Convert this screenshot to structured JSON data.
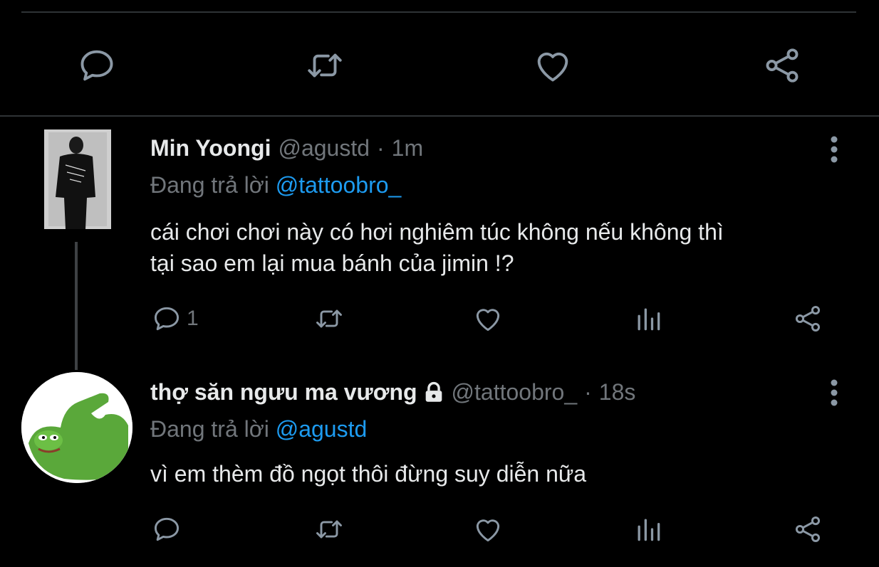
{
  "tweets": [
    {
      "name": "Min Yoongi",
      "handle": "@agustd",
      "dot": "·",
      "time": "1m",
      "reply_prefix": "Đang trả lời",
      "reply_to": "@tattoobro_",
      "text_line1": "cái chơi chơi này có hơi nghiêm túc không nếu không thì",
      "text_line2": "tại sao em lại mua bánh của jimin !?",
      "reply_count": "1",
      "avatar": "photo-of-person-in-jacket"
    },
    {
      "name": "thợ săn ngưu ma vương",
      "handle": "@tattoobro_",
      "dot": "·",
      "time": "18s",
      "reply_prefix": "Đang trả lời",
      "reply_to": "@agustd",
      "text_line1": "vì em thèm đồ ngọt thôi đừng suy diễn nữa",
      "avatar": "green-frog-cartoon",
      "protected_icon": "lock-icon"
    }
  ],
  "colors": {
    "background": "#000000",
    "text": "#e7e9ea",
    "muted": "#71767b",
    "link": "#1d9bf0",
    "icon": "#8b98a5",
    "divider": "#2f3336"
  }
}
